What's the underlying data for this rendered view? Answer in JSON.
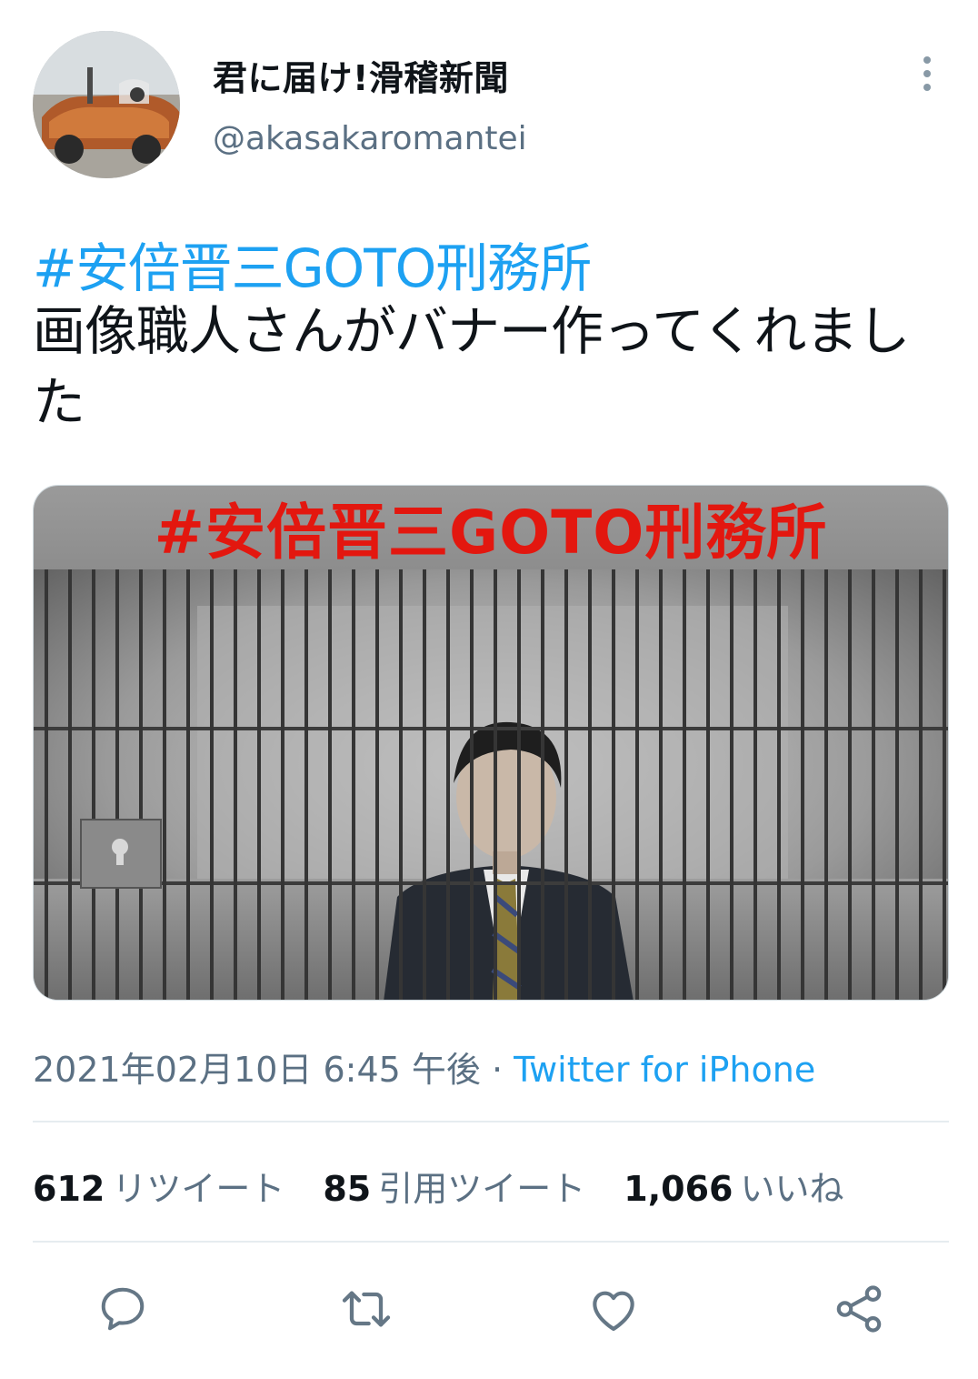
{
  "user": {
    "display_name": "君に届け!滑稽新聞",
    "handle": "@akasakaromantei"
  },
  "tweet": {
    "hashtag": "#安倍晋三GOTO刑務所",
    "body": "画像職人さんがバナー作ってくれました"
  },
  "media": {
    "banner_text": "#安倍晋三GOTO刑務所"
  },
  "meta": {
    "timestamp": "2021年02月10日 6:45 午後",
    "separator": " · ",
    "source": "Twitter for iPhone"
  },
  "stats": {
    "retweets": {
      "count": "612",
      "label": "リツイート"
    },
    "quotes": {
      "count": "85",
      "label": "引用ツイート"
    },
    "likes": {
      "count": "1,066",
      "label": "いいね"
    }
  },
  "icons": {
    "more": "more-vertical-icon",
    "reply": "reply-icon",
    "retweet": "retweet-icon",
    "like": "heart-icon",
    "share": "share-icon"
  },
  "colors": {
    "accent": "#1da1f2",
    "secondary_text": "#5b7083",
    "icon": "#657786",
    "banner_text": "#e3170f"
  }
}
